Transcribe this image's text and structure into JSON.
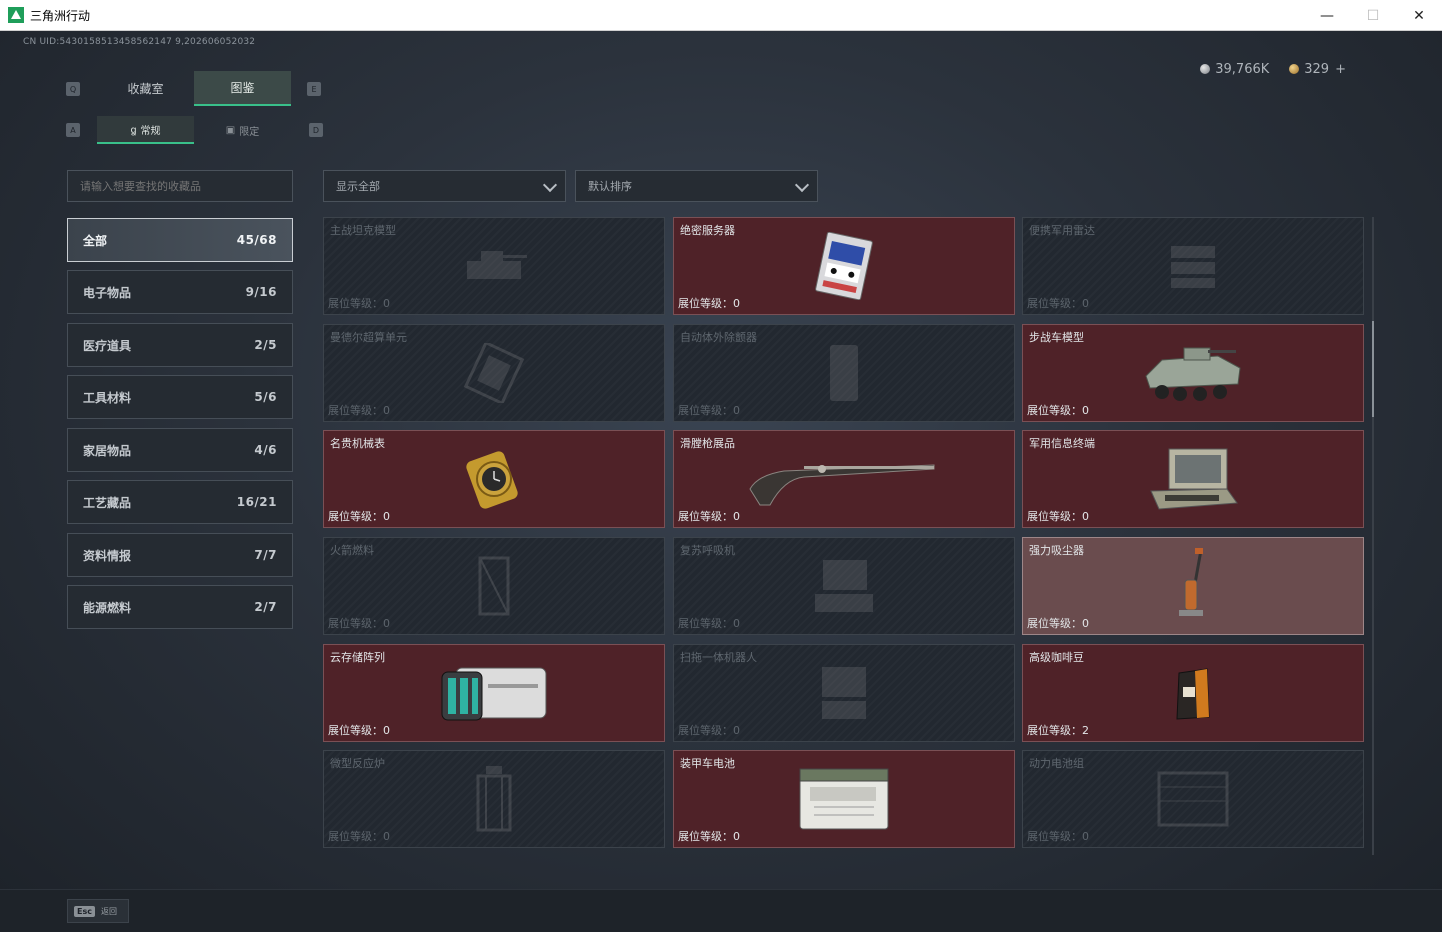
{
  "window": {
    "title": "三角洲行动",
    "minimize": "—",
    "maximize": "☐",
    "close": "✕"
  },
  "uid": "CN UID:5430158513458562147 9,202606052032",
  "currency": {
    "silver": "39,766K",
    "gold": "329"
  },
  "keyhints": {
    "tab_left": "Q",
    "tab_right": "E",
    "sub_left": "A",
    "sub_right": "D"
  },
  "tabs": [
    {
      "label": "收藏室"
    },
    {
      "label": "图鉴"
    }
  ],
  "subtabs": [
    {
      "label": "常规"
    },
    {
      "label": "限定"
    }
  ],
  "search": {
    "placeholder": "请输入想要查找的收藏品"
  },
  "filters": {
    "show": "显示全部",
    "sort": "默认排序"
  },
  "categories": [
    {
      "label": "全部",
      "count": "45/68"
    },
    {
      "label": "电子物品",
      "count": "9/16"
    },
    {
      "label": "医疗道具",
      "count": "2/5"
    },
    {
      "label": "工具材料",
      "count": "5/6"
    },
    {
      "label": "家居物品",
      "count": "4/6"
    },
    {
      "label": "工艺藏品",
      "count": "16/21"
    },
    {
      "label": "资料情报",
      "count": "7/7"
    },
    {
      "label": "能源燃料",
      "count": "2/7"
    }
  ],
  "level_prefix": "展位等级：",
  "items": [
    {
      "name": "主战坦克模型",
      "level": "0"
    },
    {
      "name": "绝密服务器",
      "level": "0"
    },
    {
      "name": "便携军用雷达",
      "level": "0"
    },
    {
      "name": "曼德尔超算单元",
      "level": "0"
    },
    {
      "name": "自动体外除颤器",
      "level": "0"
    },
    {
      "name": "步战车模型",
      "level": "0"
    },
    {
      "name": "名贵机械表",
      "level": "0"
    },
    {
      "name": "滑膛枪展品",
      "level": "0"
    },
    {
      "name": "军用信息终端",
      "level": "0"
    },
    {
      "name": "火箭燃料",
      "level": "0"
    },
    {
      "name": "复苏呼吸机",
      "level": "0"
    },
    {
      "name": "强力吸尘器",
      "level": "0"
    },
    {
      "name": "云存储阵列",
      "level": "0"
    },
    {
      "name": "扫拖一体机器人",
      "level": "0"
    },
    {
      "name": "高级咖啡豆",
      "level": "2"
    },
    {
      "name": "微型反应炉",
      "level": "0"
    },
    {
      "name": "装甲车电池",
      "level": "0"
    },
    {
      "name": "动力电池组",
      "level": "0"
    }
  ],
  "footer": {
    "esc_key": "Esc",
    "back": "返回"
  }
}
